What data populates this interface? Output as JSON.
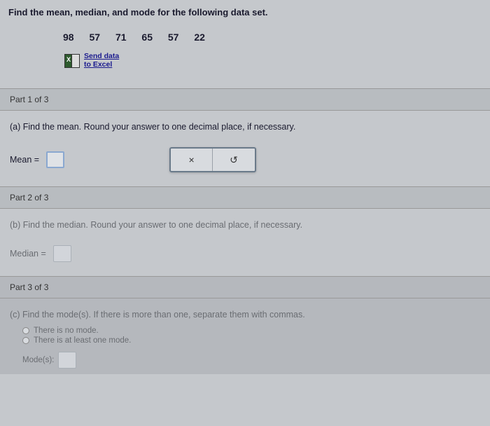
{
  "question": "Find the mean, median, and mode for the following data set.",
  "data_values": [
    "98",
    "57",
    "71",
    "65",
    "57",
    "22"
  ],
  "send_data": "Send data\nto Excel",
  "parts": {
    "p1": {
      "label": "Part 1 of 3",
      "inst": "(a) Find the mean. Round your answer to one decimal place, if necessary.",
      "answer_label": "Mean ="
    },
    "p2": {
      "label": "Part 2 of 3",
      "inst": "(b) Find the median. Round your answer to one decimal place, if necessary.",
      "answer_label": "Median ="
    },
    "p3": {
      "label": "Part 3 of 3",
      "inst": "(c) Find the mode(s). If there is more than one, separate them with commas.",
      "radio1": "There is no mode.",
      "radio2": "There is at least one mode.",
      "answer_label": "Mode(s):"
    }
  },
  "buttons": {
    "clear": "×",
    "reset": "↺"
  }
}
